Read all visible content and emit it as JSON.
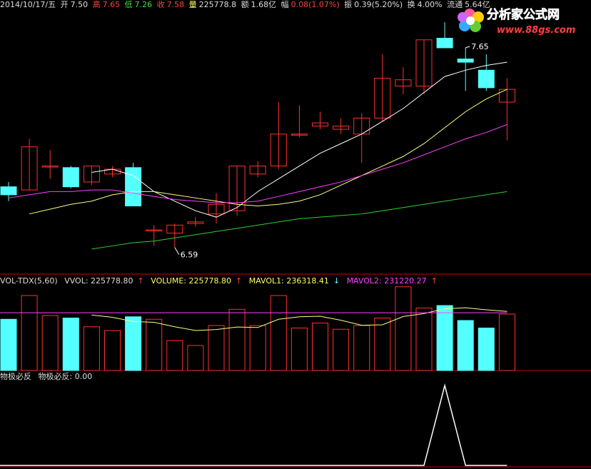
{
  "header": {
    "date": "2014/10/17/五",
    "open_label": "开",
    "open": "7.50",
    "high_label": "高",
    "high": "7.65",
    "low_label": "低",
    "low": "7.26",
    "close_label": "收",
    "close": "7.58",
    "vol_label": "量",
    "vol": "225778.8",
    "amount_label": "额",
    "amount": "1.68亿",
    "change_label": "幅",
    "change": "0.08(1.07%)",
    "amplitude_label": "振",
    "amplitude": "0.39(5.20%)",
    "turnover_label": "换",
    "turnover": "4.00%",
    "float_label": "流通",
    "float": "5.64亿"
  },
  "logo": {
    "text": "分析家公式网",
    "url_text": "www.88gs.com"
  },
  "volume_panel": {
    "name": "VOL-TDX(5,60)",
    "vvol": "VVOL: 225778.80",
    "volume": "VOLUME: 225778.80",
    "mavol1": "MAVOL1: 236318.41",
    "mavol2": "MAVOL2: 231220.27",
    "arrow_up": "↑",
    "arrow_down": "↓"
  },
  "indicator_panel": {
    "name": "物极必反",
    "value": "物极必反: 0.00"
  },
  "colors": {
    "up": "#ff3030",
    "down": "#54ffff",
    "ma_white": "#ffffff",
    "ma_yellow": "#ffff80",
    "ma_magenta": "#ff40ff",
    "ma_green": "#30d030",
    "axis": "#c80000",
    "indicator": "#ffffff"
  },
  "chart_data": {
    "type": "candlestick",
    "price_range": [
      6.4,
      7.75
    ],
    "annotations": [
      {
        "label": "6.59",
        "bar": 8
      },
      {
        "label": "7.65",
        "bar": 22
      }
    ],
    "candles": [
      {
        "o": 6.97,
        "h": 7.0,
        "l": 6.88,
        "c": 6.92
      },
      {
        "o": 6.95,
        "h": 7.27,
        "l": 6.95,
        "c": 7.22
      },
      {
        "o": 7.1,
        "h": 7.2,
        "l": 7.02,
        "c": 7.1
      },
      {
        "o": 7.09,
        "h": 7.1,
        "l": 6.96,
        "c": 6.97
      },
      {
        "o": 7.0,
        "h": 7.1,
        "l": 6.98,
        "c": 7.1
      },
      {
        "o": 7.05,
        "h": 7.1,
        "l": 7.03,
        "c": 7.08
      },
      {
        "o": 7.09,
        "h": 7.12,
        "l": 6.85,
        "c": 6.85
      },
      {
        "o": 6.7,
        "h": 6.73,
        "l": 6.6,
        "c": 6.7
      },
      {
        "o": 6.68,
        "h": 6.74,
        "l": 6.59,
        "c": 6.73
      },
      {
        "o": 6.74,
        "h": 6.78,
        "l": 6.72,
        "c": 6.75
      },
      {
        "o": 6.8,
        "h": 6.93,
        "l": 6.74,
        "c": 6.86
      },
      {
        "o": 6.82,
        "h": 7.1,
        "l": 6.79,
        "c": 7.1
      },
      {
        "o": 7.05,
        "h": 7.13,
        "l": 7.03,
        "c": 7.1
      },
      {
        "o": 7.1,
        "h": 7.5,
        "l": 7.08,
        "c": 7.3
      },
      {
        "o": 7.3,
        "h": 7.48,
        "l": 7.28,
        "c": 7.3
      },
      {
        "o": 7.35,
        "h": 7.44,
        "l": 7.33,
        "c": 7.37
      },
      {
        "o": 7.33,
        "h": 7.4,
        "l": 7.3,
        "c": 7.35
      },
      {
        "o": 7.3,
        "h": 7.43,
        "l": 7.12,
        "c": 7.4
      },
      {
        "o": 7.4,
        "h": 7.8,
        "l": 7.38,
        "c": 7.65
      },
      {
        "o": 7.6,
        "h": 7.72,
        "l": 7.55,
        "c": 7.64
      },
      {
        "o": 7.6,
        "h": 7.89,
        "l": 7.55,
        "c": 7.89
      },
      {
        "o": 7.9,
        "h": 8.0,
        "l": 7.85,
        "c": 7.84
      },
      {
        "o": 7.77,
        "h": 7.84,
        "l": 7.57,
        "c": 7.75
      },
      {
        "o": 7.7,
        "h": 7.8,
        "l": 7.57,
        "c": 7.59
      },
      {
        "o": 7.5,
        "h": 7.65,
        "l": 7.26,
        "c": 7.58
      }
    ],
    "ma_lines": [
      {
        "name": "MA5",
        "color": "#ffffff",
        "values": [
          null,
          null,
          null,
          null,
          7.06,
          7.08,
          7.04,
          6.94,
          6.88,
          6.82,
          6.78,
          6.84,
          6.94,
          7.02,
          7.1,
          7.18,
          7.24,
          7.3,
          7.38,
          7.46,
          7.56,
          7.66,
          7.7,
          7.73,
          7.75
        ]
      },
      {
        "name": "MA10",
        "color": "#ffff80",
        "values": [
          null,
          6.8,
          6.83,
          6.86,
          6.88,
          6.92,
          6.94,
          6.94,
          6.92,
          6.9,
          6.88,
          6.86,
          6.85,
          6.86,
          6.88,
          6.92,
          6.98,
          7.04,
          7.1,
          7.16,
          7.24,
          7.34,
          7.44,
          7.52,
          7.58
        ]
      },
      {
        "name": "MA20",
        "color": "#ff40ff",
        "values": [
          6.9,
          6.92,
          6.94,
          6.94,
          6.95,
          6.95,
          6.93,
          6.91,
          6.89,
          6.88,
          6.87,
          6.87,
          6.88,
          6.91,
          6.94,
          6.97,
          7.0,
          7.04,
          7.08,
          7.12,
          7.17,
          7.22,
          7.27,
          7.31,
          7.36
        ]
      },
      {
        "name": "MA60",
        "color": "#30d030",
        "values": [
          null,
          null,
          null,
          null,
          6.58,
          6.6,
          6.62,
          6.63,
          6.65,
          6.67,
          6.69,
          6.71,
          6.73,
          6.75,
          6.77,
          6.78,
          6.79,
          6.8,
          6.82,
          6.84,
          6.86,
          6.88,
          6.9,
          6.92,
          6.94
        ]
      }
    ],
    "volume": {
      "range": [
        0,
        340000
      ],
      "values": [
        205000,
        300000,
        220000,
        210000,
        175000,
        160000,
        215000,
        205000,
        120000,
        100000,
        180000,
        245000,
        180000,
        300000,
        170000,
        190000,
        165000,
        180000,
        210000,
        335000,
        250000,
        260000,
        200000,
        170000,
        225779
      ],
      "mavol1": [
        null,
        null,
        null,
        null,
        222000,
        213000,
        196000,
        193000,
        175000,
        160000,
        164000,
        174000,
        172000,
        205000,
        215000,
        217000,
        201000,
        181000,
        183000,
        216000,
        228000,
        247000,
        251000,
        243000,
        236318
      ],
      "mavol2": [
        null,
        null,
        null,
        null,
        null,
        null,
        null,
        null,
        null,
        null,
        null,
        null,
        null,
        null,
        null,
        null,
        null,
        null,
        null,
        null,
        null,
        null,
        null,
        null,
        231220
      ]
    },
    "indicator": {
      "values": [
        0,
        0,
        0,
        0,
        0,
        0,
        0,
        0,
        0,
        0,
        0,
        0,
        0,
        0,
        0,
        0,
        0,
        0,
        0,
        0,
        0,
        1,
        0,
        0,
        0
      ]
    }
  }
}
